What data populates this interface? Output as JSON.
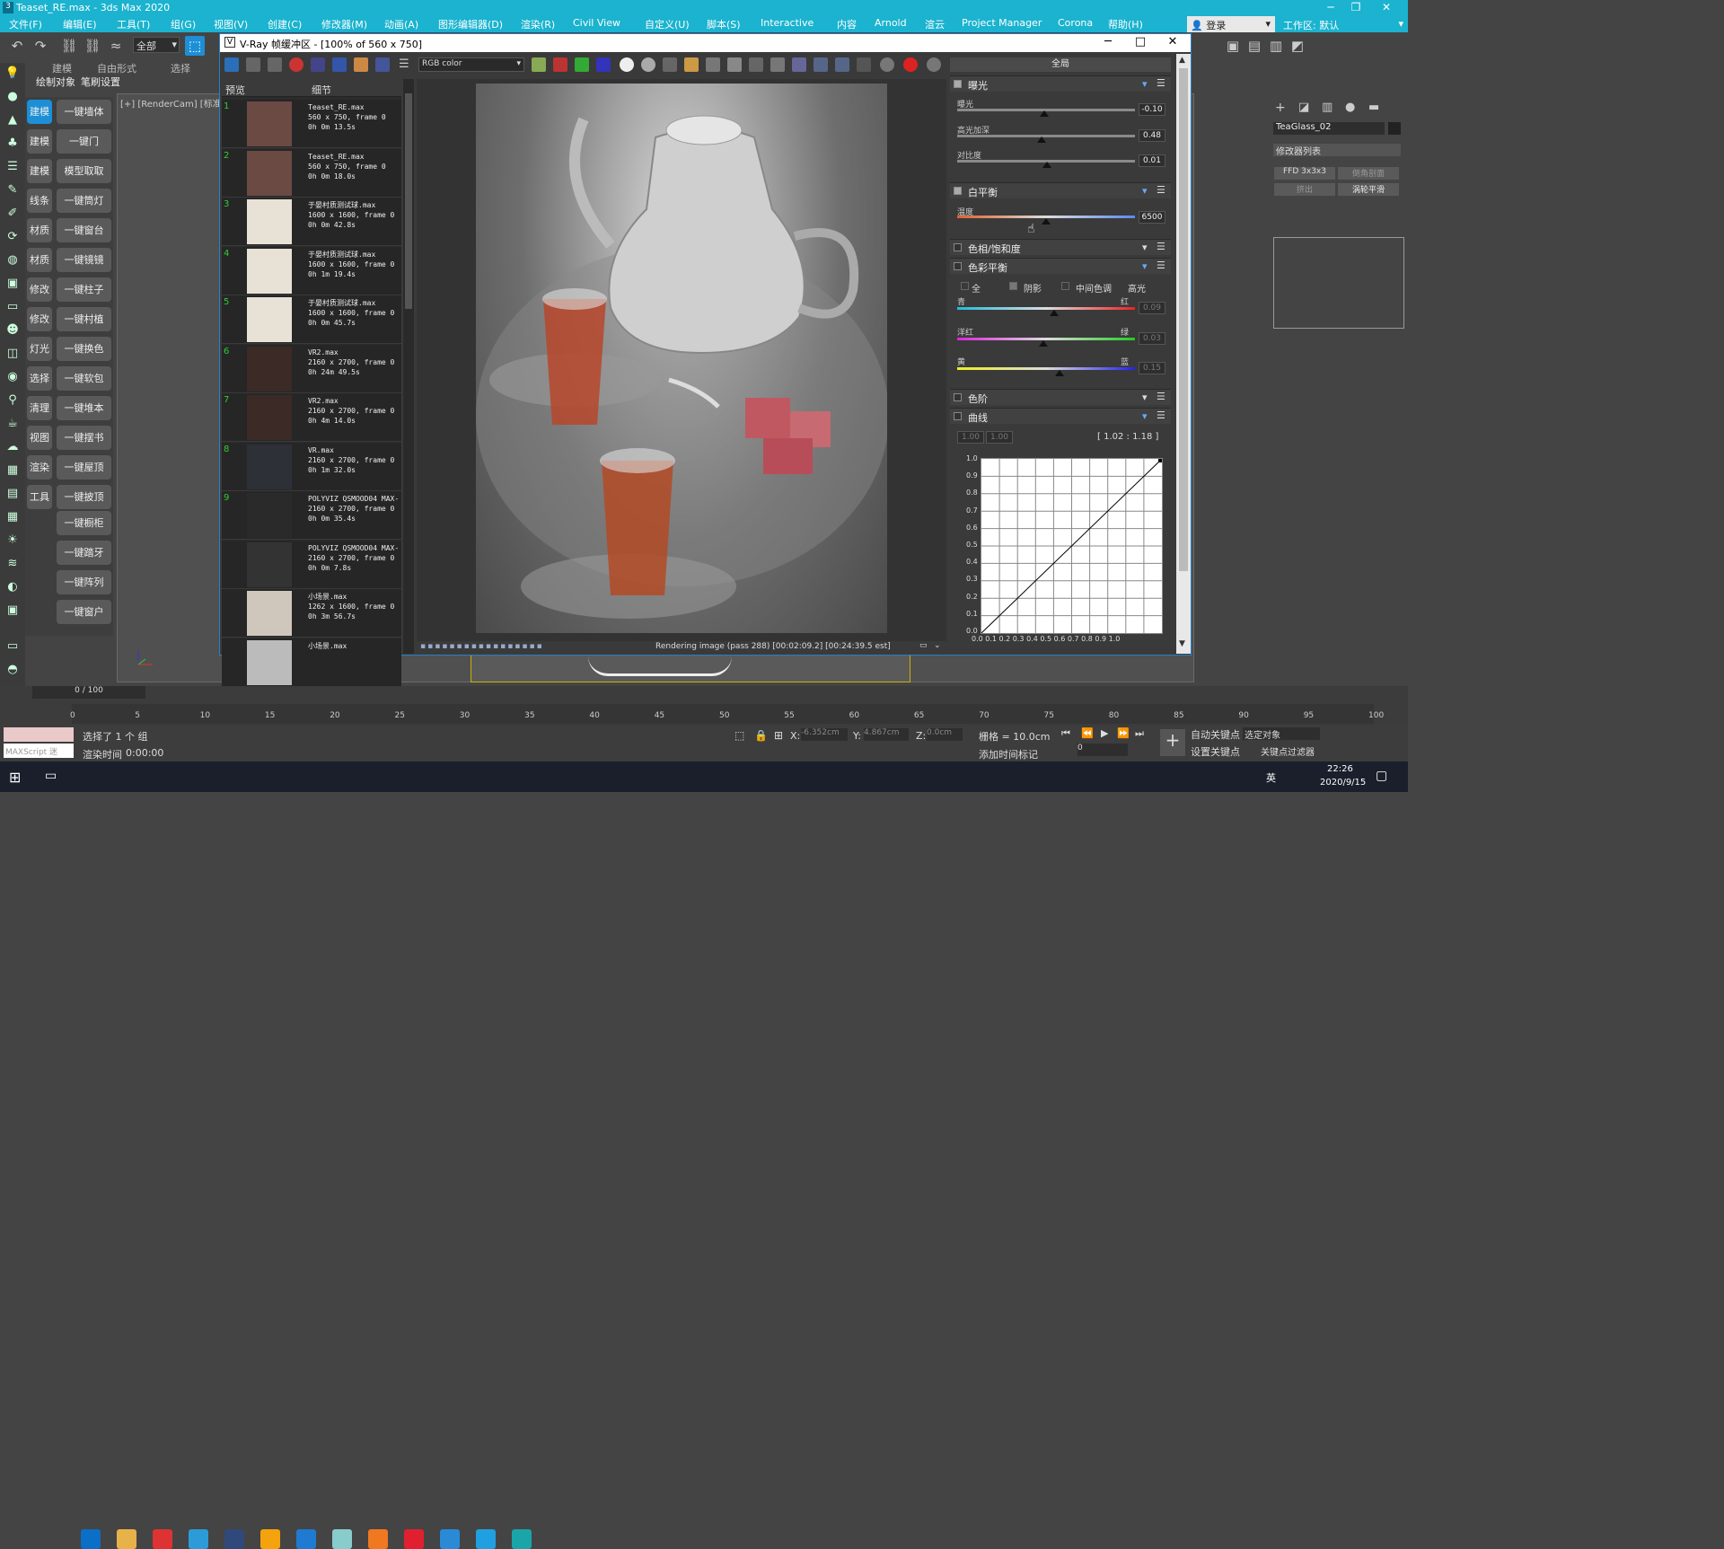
{
  "window": {
    "title": "Teaset_RE.max - 3ds Max 2020",
    "min": "─",
    "max": "❐",
    "close": "✕"
  },
  "menus": [
    "文件(F)",
    "编辑(E)",
    "工具(T)",
    "组(G)",
    "视图(V)",
    "创建(C)",
    "修改器(M)",
    "动画(A)",
    "图形编辑器(D)",
    "渲染(R)",
    "Civil View",
    "自定义(U)",
    "脚本(S)",
    "Interactive",
    "内容",
    "Arnold",
    "渲云",
    "Project Manager",
    "Corona",
    "帮助(H)"
  ],
  "login": "登录",
  "workspace_label": "工作区:",
  "workspace_value": "默认",
  "toolbar": {
    "selection_filter": "全部"
  },
  "ribbon": {
    "tabs": [
      "建模",
      "自由形式",
      "选择"
    ],
    "sub": [
      "绘制对象",
      "笔刷设置"
    ]
  },
  "script_buttons": {
    "left": [
      "建模1",
      "建模2",
      "建模3",
      "线条",
      "材质1",
      "材质2",
      "修改1",
      "修改2",
      "灯光",
      "选择",
      "清理",
      "视图",
      "渲染",
      "工具"
    ],
    "right": [
      "一键墙体",
      "一键门",
      "模型取取",
      "一键筒灯",
      "一键窗台",
      "一键镜镜",
      "一键柱子",
      "一键村植",
      "一键换色",
      "一键软包",
      "一键堆本",
      "一键摆书",
      "一键屋顶",
      "一键披顶",
      "一键橱柜",
      "一键踏牙",
      "一键阵列",
      "一键窗户"
    ]
  },
  "viewport_label": "[+] [RenderCam] [标准]",
  "vfb": {
    "title": "V-Ray 帧缓冲区 - [100% of 560 x 750]",
    "channel": "RGB color",
    "global_tab": "全局",
    "history_headers": {
      "preview": "预览",
      "detail": "细节"
    },
    "history": [
      {
        "n": "1",
        "file": "Teaset_RE.max",
        "info": "560 x 750, frame 0",
        "time": "0h 0m 13.5s"
      },
      {
        "n": "2",
        "file": "Teaset_RE.max",
        "info": "560 x 750, frame 0",
        "time": "0h 0m 18.0s"
      },
      {
        "n": "3",
        "file": "于晏村质测试球.max",
        "info": "1600 x 1600, frame 0",
        "time": "0h 0m 42.8s"
      },
      {
        "n": "4",
        "file": "于晏村质测试球.max",
        "info": "1600 x 1600, frame 0",
        "time": "0h 1m 19.4s"
      },
      {
        "n": "5",
        "file": "于晏村质测试球.max",
        "info": "1600 x 1600, frame 0",
        "time": "0h 0m 45.7s"
      },
      {
        "n": "6",
        "file": "VR2.max",
        "info": "2160 x 2700, frame 0",
        "time": "0h 24m 49.5s"
      },
      {
        "n": "7",
        "file": "VR2.max",
        "info": "2160 x 2700, frame 0",
        "time": "0h 4m 14.0s"
      },
      {
        "n": "8",
        "file": "VR.max",
        "info": "2160 x 2700, frame 0",
        "time": "0h 1m 32.0s"
      },
      {
        "n": "9",
        "file": "POLYVIZ QSMOOD04 MAX-",
        "info": "2160 x 2700, frame 0",
        "time": "0h 0m 35.4s"
      },
      {
        "n": "",
        "file": "POLYVIZ QSMOOD04 MAX-",
        "info": "2160 x 2700, frame 0",
        "time": "0h 0m 7.8s"
      },
      {
        "n": "",
        "file": "小场景.max",
        "info": "1262 x 1600, frame 0",
        "time": "0h 3m 56.7s"
      },
      {
        "n": "",
        "file": "小场景.max",
        "info": "",
        "time": ""
      }
    ],
    "status": "Rendering image (pass 288) [00:02:09.2] [00:24:39.5 est]",
    "exposure": {
      "title": "曝光",
      "exposure_label": "曝光",
      "exposure": "-0.10",
      "highlight_label": "高光加深",
      "highlight": "0.48",
      "contrast_label": "对比度",
      "contrast": "0.01"
    },
    "white_balance": {
      "title": "白平衡",
      "temp_label": "温度",
      "temp": "6500"
    },
    "hue_sat": {
      "title": "色相/饱和度"
    },
    "color_balance": {
      "title": "色彩平衡",
      "opt_all": "全",
      "opt_shadow": "阴影",
      "opt_mid": "中间色调",
      "opt_high": "高光",
      "c1l": "青",
      "c1r": "红",
      "v1": "0.09",
      "c2l": "洋红",
      "c2r": "绿",
      "v2": "0.03",
      "c3l": "黄",
      "c3r": "蓝",
      "v3": "0.15"
    },
    "levels": {
      "title": "色阶"
    },
    "curves": {
      "title": "曲线",
      "in1": "1.00",
      "in2": "1.00",
      "range": "[ 1.02 : 1.18 ]",
      "ylabels": [
        "1.0",
        "0.9",
        "0.8",
        "0.7",
        "0.6",
        "0.5",
        "0.4",
        "0.3",
        "0.2",
        "0.1",
        "0.0"
      ],
      "xlabels": "0.0 0.1 0.2 0.3 0.4 0.5 0.6 0.7 0.8 0.9 1.0"
    }
  },
  "cmd": {
    "object": "TeaGlass_02",
    "modlist": "修改器列表",
    "btn1": "FFD 3x3x3",
    "btn2": "倒角剖面",
    "btn3": "挤出",
    "btn4": "涡轮平滑"
  },
  "timeline": {
    "frame": "0 / 100",
    "ticks": [
      "0",
      "5",
      "10",
      "15",
      "20",
      "25",
      "30",
      "35",
      "40",
      "45",
      "50",
      "55",
      "60",
      "65",
      "70",
      "75",
      "80",
      "85",
      "90",
      "95",
      "100"
    ]
  },
  "status": {
    "maxscript": "MAXScript 迷",
    "selected": "选择了 1 个 组",
    "render_time_label": "渲染时间",
    "render_time": "0:00:00",
    "x": "X:",
    "y": "Y:",
    "z": "Z:",
    "xv": "-6.352cm",
    "yv": "4.867cm",
    "zv": "0.0cm",
    "grid": "栅格 = 10.0cm",
    "add_tag": "添加时间标记",
    "autokey": "自动关键点",
    "setkey": "设置关键点",
    "sel_obj": "选定对象",
    "key_filter": "关键点过滤器",
    "frame_field": "0"
  },
  "clock": {
    "time": "22:26",
    "date": "2020/9/15",
    "ime": "英"
  }
}
